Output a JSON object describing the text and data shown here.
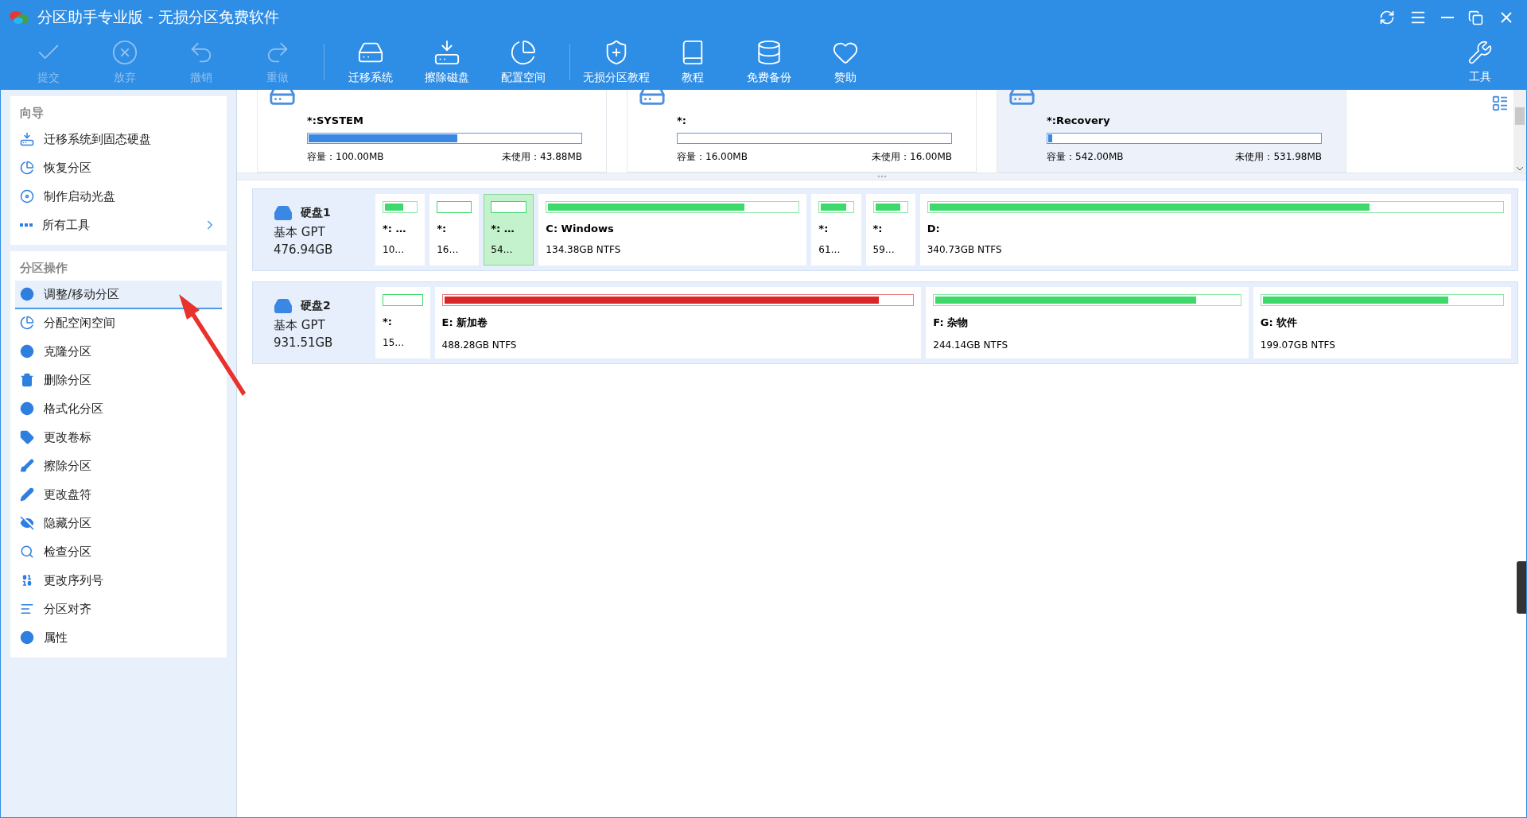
{
  "window": {
    "title": "分区助手专业版 - 无损分区免费软件"
  },
  "toolbar": {
    "groups": [
      [
        {
          "label": "提交",
          "disabled": true
        },
        {
          "label": "放弃",
          "disabled": true
        },
        {
          "label": "撤销",
          "disabled": true
        },
        {
          "label": "重做",
          "disabled": true
        }
      ],
      [
        {
          "label": "迁移系统",
          "disabled": false
        },
        {
          "label": "擦除磁盘",
          "disabled": false
        },
        {
          "label": "配置空间",
          "disabled": false
        }
      ],
      [
        {
          "label": "无损分区教程",
          "disabled": false
        },
        {
          "label": "教程",
          "disabled": false
        },
        {
          "label": "免费备份",
          "disabled": false
        },
        {
          "label": "赞助",
          "disabled": false
        }
      ]
    ],
    "tools_button": {
      "label": "工具"
    }
  },
  "sidebar": {
    "sections": [
      {
        "title": "向导",
        "items": [
          {
            "label": "迁移系统到固态硬盘",
            "selected": false,
            "submenu": false
          },
          {
            "label": "恢复分区",
            "selected": false,
            "submenu": false
          },
          {
            "label": "制作启动光盘",
            "selected": false,
            "submenu": false
          },
          {
            "label": "所有工具",
            "selected": false,
            "submenu": true
          }
        ]
      },
      {
        "title": "分区操作",
        "items": [
          {
            "label": "调整/移动分区",
            "selected": true,
            "submenu": false
          },
          {
            "label": "分配空闲空间",
            "selected": false,
            "submenu": false
          },
          {
            "label": "克隆分区",
            "selected": false,
            "submenu": false
          },
          {
            "label": "删除分区",
            "selected": false,
            "submenu": false
          },
          {
            "label": "格式化分区",
            "selected": false,
            "submenu": false
          },
          {
            "label": "更改卷标",
            "selected": false,
            "submenu": false
          },
          {
            "label": "擦除分区",
            "selected": false,
            "submenu": false
          },
          {
            "label": "更改盘符",
            "selected": false,
            "submenu": false
          },
          {
            "label": "隐藏分区",
            "selected": false,
            "submenu": false
          },
          {
            "label": "检查分区",
            "selected": false,
            "submenu": false
          },
          {
            "label": "更改序列号",
            "selected": false,
            "submenu": false
          },
          {
            "label": "分区对齐",
            "selected": false,
            "submenu": false
          },
          {
            "label": "属性",
            "selected": false,
            "submenu": false
          }
        ]
      }
    ]
  },
  "partition_cards": [
    {
      "name": "*:SYSTEM",
      "level": 0.55,
      "capacity": "容量：100.00MB",
      "unused": "未使用：43.88MB",
      "selected": false
    },
    {
      "name": "*:",
      "capacity": "容量：16.00MB",
      "unused": "未使用：16.00MB",
      "selected": false
    },
    {
      "name": "*:Recovery",
      "level": 0.02,
      "capacity": "容量：542.00MB",
      "unused": "未使用：531.98MB",
      "selected": true
    }
  ],
  "disks": [
    {
      "name": "硬盘1",
      "type": "基本 GPT",
      "size": "476.94GB",
      "partitions": [
        {
          "label": "*: …",
          "info": "10…",
          "level": 0.65,
          "selected": false,
          "color": "#3ed96a"
        },
        {
          "label": "*:",
          "info": "16…",
          "selected": false,
          "color": "#3ed96a"
        },
        {
          "label": "*: …",
          "info": "54…",
          "selected": true,
          "color": "#3ed96a"
        },
        {
          "label": "C: Windows",
          "info": "134.38GB NTFS",
          "level": 0.79,
          "selected": false,
          "color": "#3ed96a"
        },
        {
          "label": "*:",
          "info": "61…",
          "level": 0.85,
          "selected": false,
          "color": "#3ed96a"
        },
        {
          "label": "*:",
          "info": "59…",
          "level": 0.85,
          "selected": false,
          "color": "#3ed96a"
        },
        {
          "label": "D:",
          "info": "340.73GB NTFS",
          "level": 0.77,
          "selected": false,
          "color": "#3ed96a"
        }
      ]
    },
    {
      "name": "硬盘2",
      "type": "基本 GPT",
      "size": "931.51GB",
      "partitions": [
        {
          "label": "*:",
          "info": "15…",
          "selected": false,
          "color": "#3ed96a"
        },
        {
          "label": "E: 新加卷",
          "info": "488.28GB NTFS",
          "level": 0.93,
          "selected": false,
          "color": "#d92626"
        },
        {
          "label": "F: 杂物",
          "info": "244.14GB NTFS",
          "level": 0.86,
          "selected": false,
          "color": "#3ed96a"
        },
        {
          "label": "G: 软件",
          "info": "199.07GB NTFS",
          "level": 0.78,
          "selected": false,
          "color": "#3ed96a"
        }
      ]
    }
  ]
}
